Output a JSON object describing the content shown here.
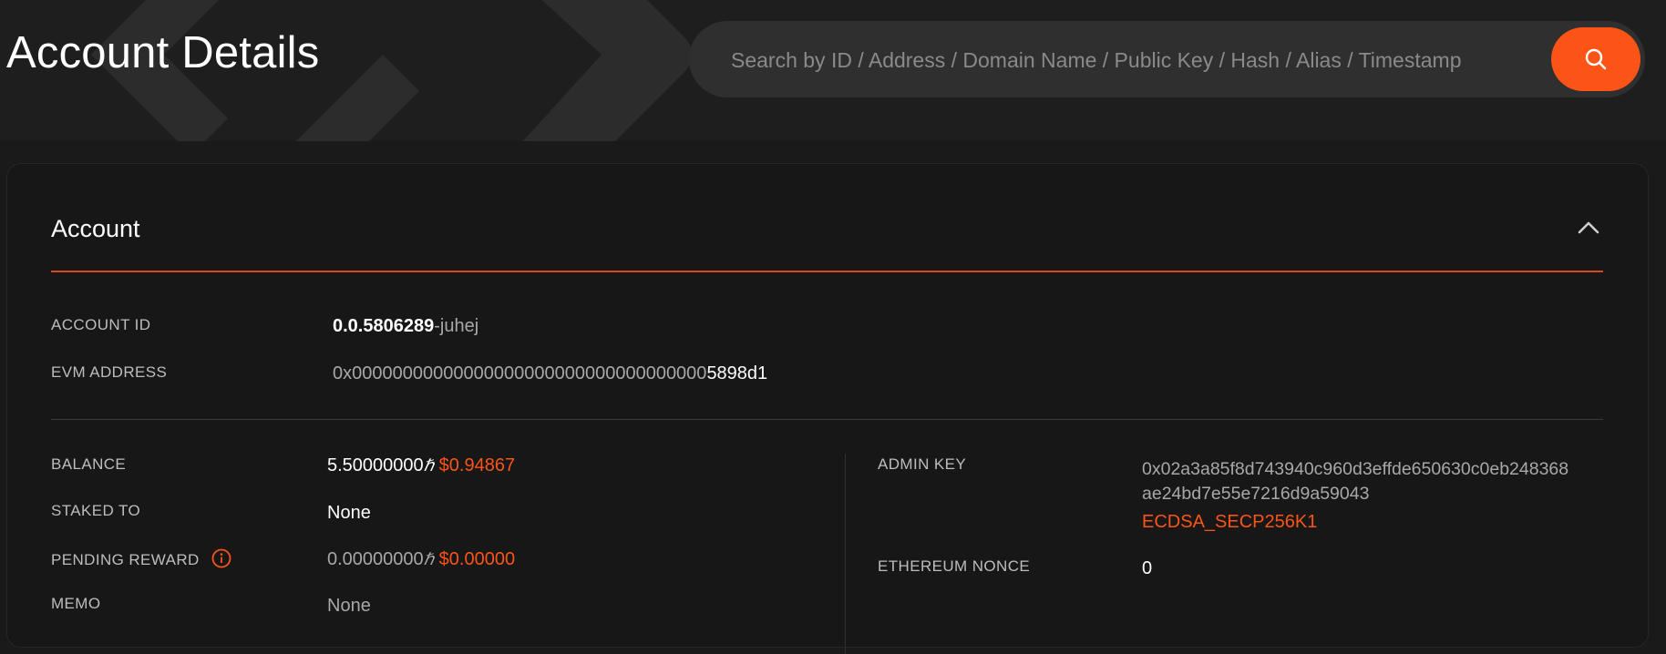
{
  "header": {
    "title": "Account Details",
    "search_placeholder": "Search by ID / Address / Domain Name / Public Key / Hash / Alias / Timestamp"
  },
  "card": {
    "title": "Account",
    "account_id_label": "ACCOUNT ID",
    "account_id_main": "0.0.5806289",
    "account_id_checksum": "-juhej",
    "evm_address_label": "EVM ADDRESS",
    "evm_address_prefix": "0x00000000000000000000000000000000000",
    "evm_address_suffix": "5898d1",
    "balance_label": "BALANCE",
    "balance_hbar": "5.50000000",
    "balance_usd": "$0.94867",
    "staked_to_label": "STAKED TO",
    "staked_to_value": "None",
    "pending_reward_label": "PENDING REWARD",
    "pending_reward_hbar": "0.00000000",
    "pending_reward_usd": "$0.00000",
    "memo_label": "MEMO",
    "memo_value": "None",
    "admin_key_label": "ADMIN KEY",
    "admin_key_line1": "0x02a3a85f8d743940c960d3effde650630c0eb248368",
    "admin_key_line2": "ae24bd7e55e7216d9a59043",
    "admin_key_type": "ECDSA_SECP256K1",
    "ethereum_nonce_label": "ETHEREUM NONCE",
    "ethereum_nonce_value": "0",
    "hbar_symbol": "ℏ"
  },
  "colors": {
    "accent": "#fb5416",
    "background": "#1a1a1a",
    "card": "#171717"
  },
  "icons": [
    "search-icon",
    "chevron-up-icon",
    "info-icon",
    "hero-logo"
  ]
}
